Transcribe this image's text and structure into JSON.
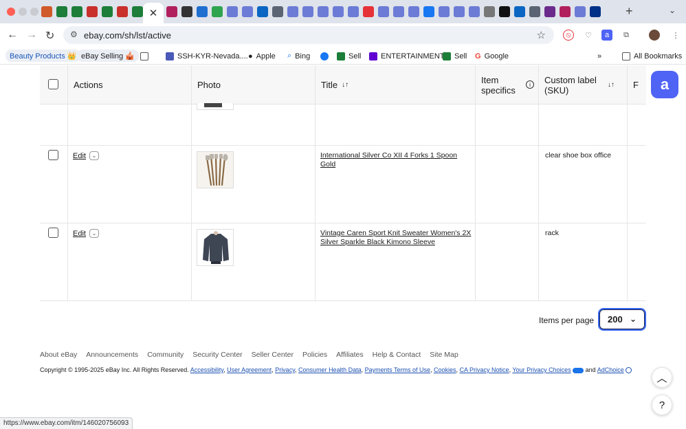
{
  "browser": {
    "url": "ebay.com/sh/lst/active",
    "tab_colors": [
      "#d05a2a",
      "#1c7e39",
      "#1c7e39",
      "#c9302c",
      "#1c7e39",
      "#c9302c",
      "#1c7e39",
      "#ca2f7c"
    ],
    "tab_colors_after": [
      "#b11f5c",
      "#333333",
      "#1f6fd1",
      "#2ea44f",
      "#6b7bd6",
      "#6b7bd6",
      "#0a66c2",
      "#5b6472",
      "#6b7bd6",
      "#6b7bd6",
      "#6b7bd6",
      "#6b7bd6",
      "#6b7bd6",
      "#e53238",
      "#6b7bd6",
      "#6b7bd6",
      "#6b7bd6",
      "#1877f2",
      "#6b7bd6",
      "#6b7bd6",
      "#6b7bd6",
      "#777777",
      "#111111",
      "#0a66c2",
      "#5b6472",
      "#6b2b8c",
      "#b11f5c",
      "#6b7bd6",
      "#003087",
      "#ff0000",
      "#1c7e39",
      "#1c7e39",
      "#1c7e39",
      "#e53238"
    ]
  },
  "bookmarks": [
    {
      "label": "Beauty Products 👑",
      "style": "pill-blue"
    },
    {
      "label": "eBay Selling 🎪",
      "style": "pill"
    },
    {
      "label": "SSH-KYR-Nevada....",
      "icon": "grid-icon"
    },
    {
      "label": "Apple",
      "icon": "apple-icon"
    },
    {
      "label": "Bing",
      "icon": "search-icon"
    },
    {
      "label": "",
      "icon": "facebook-icon"
    },
    {
      "label": "Sell",
      "icon": "ebay-icon"
    },
    {
      "label": "ENTERTAINMENT",
      "icon": "yahoo-icon"
    },
    {
      "label": "Sell",
      "icon": "ebay-icon"
    },
    {
      "label": "Google",
      "icon": "google-icon"
    }
  ],
  "all_bookmarks": "All Bookmarks",
  "more_bookmarks": "»",
  "table": {
    "headers": {
      "actions": "Actions",
      "photo": "Photo",
      "title": "Title",
      "item_specifics_1": "Item",
      "item_specifics_2": "specifics",
      "sku_1": "Custom label",
      "sku_2": "(SKU)",
      "next": "F"
    },
    "sort_icon": "↓↑",
    "info_icon": "i",
    "edit_label": "Edit",
    "rows": [
      {
        "title": "International Silver Co XII 4 Forks 1 Spoon Gold",
        "title_2": "",
        "sku": "clear shoe box office"
      },
      {
        "title": "Vintage Caren Sport Knit Sweater Women's 2X",
        "title_2": "Silver Sparkle Black Kimono Sleeve",
        "sku": "rack"
      }
    ]
  },
  "pagination": {
    "label": "Items per page",
    "value": "200"
  },
  "footer": {
    "links": [
      "About eBay",
      "Announcements",
      "Community",
      "Security Center",
      "Seller Center",
      "Policies",
      "Affiliates",
      "Help & Contact",
      "Site Map"
    ],
    "copyright": "Copyright © 1995-2025 eBay Inc. All Rights Reserved.",
    "legal_links": [
      "Accessibility",
      "User Agreement",
      "Privacy",
      "Consumer Health Data",
      "Payments Terms of Use",
      "Cookies",
      "CA Privacy Notice",
      "Your Privacy Choices"
    ],
    "and": "and",
    "adchoice": "AdChoice"
  },
  "status_url": "https://www.ebay.com/itm/146020756093",
  "help_label": "?",
  "float_label": "a"
}
